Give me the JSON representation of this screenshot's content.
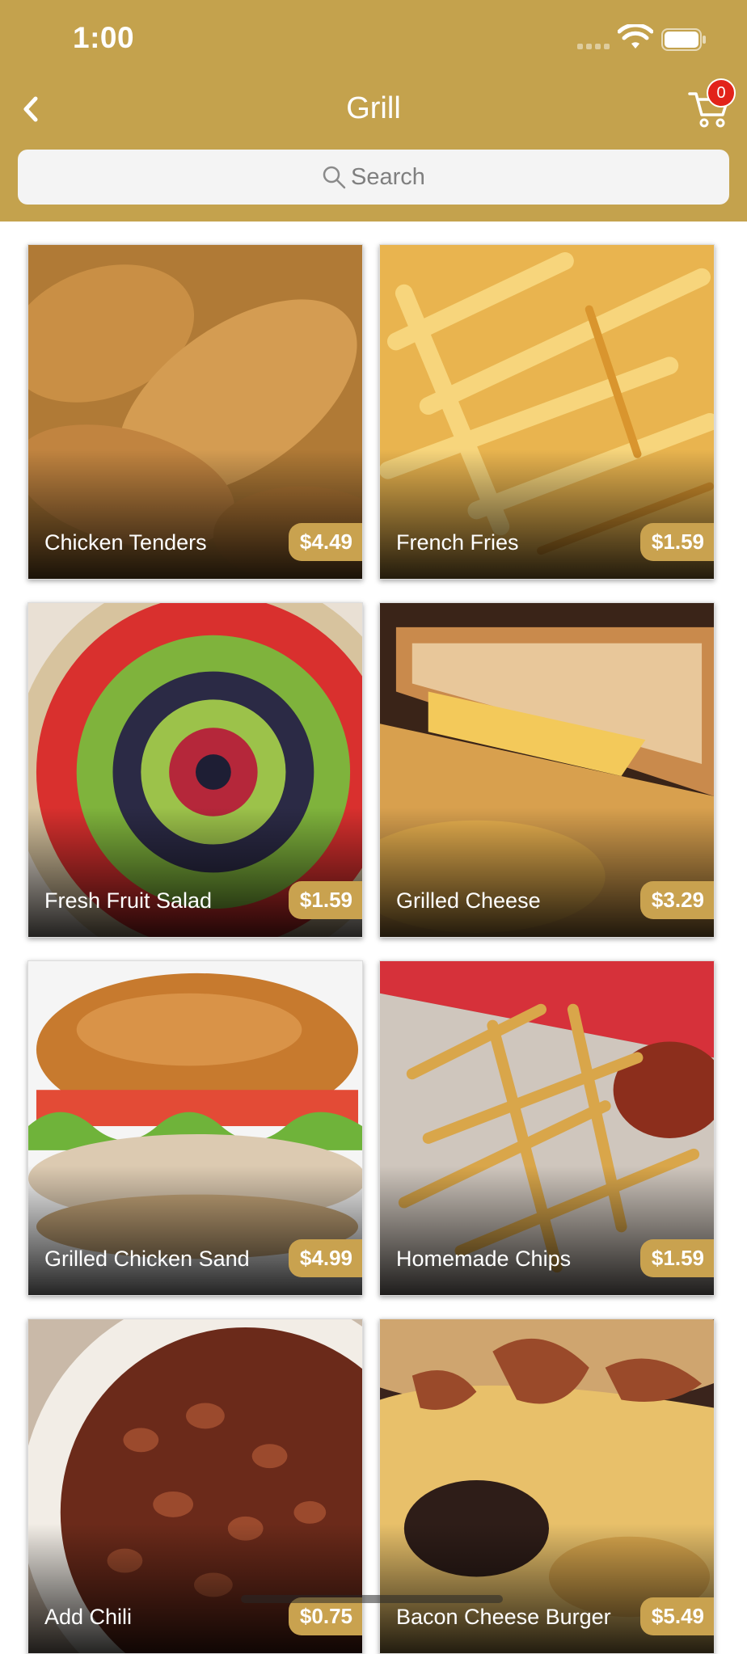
{
  "status": {
    "time": "1:00"
  },
  "header": {
    "title": "Grill",
    "cart_count": "0"
  },
  "search": {
    "placeholder": "Search"
  },
  "items": [
    {
      "name": "Chicken Tenders",
      "price": "$4.49"
    },
    {
      "name": "French Fries",
      "price": "$1.59"
    },
    {
      "name": "Fresh Fruit Salad",
      "price": "$1.59"
    },
    {
      "name": "Grilled Cheese",
      "price": "$3.29"
    },
    {
      "name": "Grilled Chicken  Sand",
      "price": "$4.99"
    },
    {
      "name": "Homemade Chips",
      "price": "$1.59"
    },
    {
      "name": "Add Chili",
      "price": "$0.75"
    },
    {
      "name": "Bacon Cheese Burger",
      "price": "$5.49"
    }
  ],
  "colors": {
    "brand": "#c4a24d",
    "badge": "#e2231a",
    "price_tag": "#c9a24f"
  },
  "icons": {
    "back": "chevron-left-icon",
    "cart": "cart-icon",
    "search": "magnifier-icon"
  }
}
